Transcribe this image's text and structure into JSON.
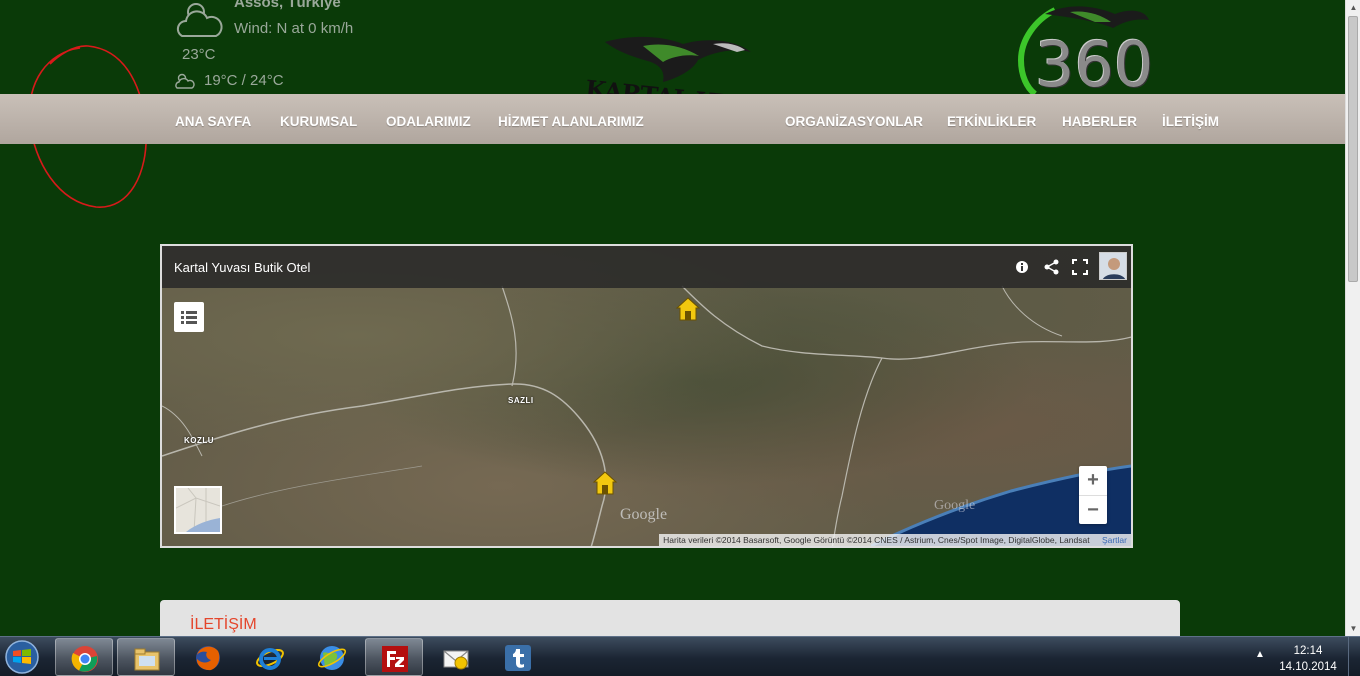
{
  "weather": {
    "location": "Assos, Türkiye",
    "wind": "Wind: N at 0 km/h",
    "temp": "23°C",
    "range": "19°C / 24°C"
  },
  "logo": {
    "text": "KARTAL YUVASI",
    "badge": "360"
  },
  "nav": {
    "items": [
      "ANA SAYFA",
      "KURUMSAL",
      "ODALARIMIZ",
      "HİZMET ALANLARIMIZ",
      "ORGANİZASYONLAR",
      "ETKİNLİKLER",
      "HABERLER",
      "İLETİŞİM"
    ]
  },
  "map": {
    "title": "Kartal Yuvası Butik Otel",
    "places": [
      "SAZLI",
      "KOZLU"
    ],
    "google": "Google",
    "attribution": "Harita verileri ©2014 Basarsoft, Google Görüntü ©2014 CNES / Astrium, Cnes/Spot Image, DigitalGlobe, Landsat",
    "terms": "Şartlar",
    "zoom_in": "+",
    "zoom_out": "−"
  },
  "contact": {
    "title": "İLETİŞİM"
  },
  "taskbar": {
    "time": "12:14",
    "date": "14.10.2014"
  },
  "colors": {
    "page_bg": "#0a3a08",
    "accent": "#e4462c",
    "navbar": "#bdb4ac"
  }
}
